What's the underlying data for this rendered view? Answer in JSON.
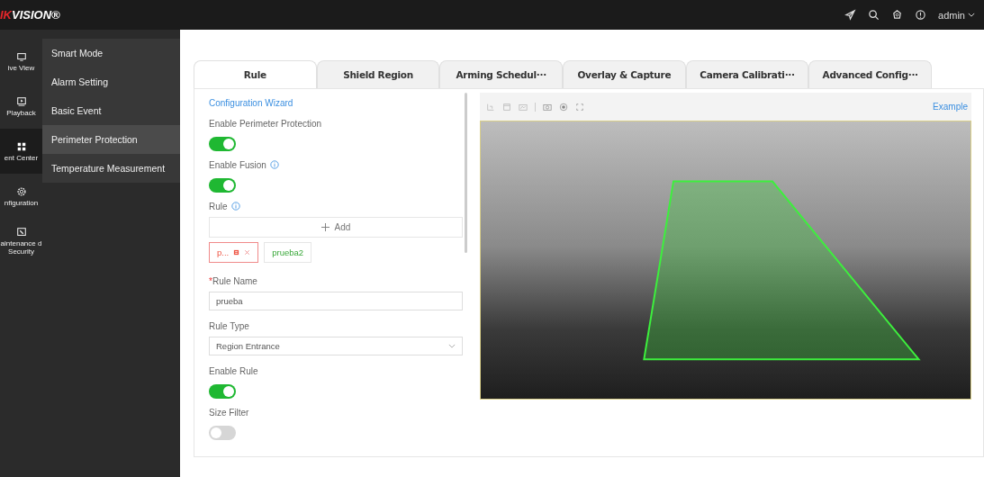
{
  "logo": {
    "accent": "IK",
    "rest": "VISION®"
  },
  "topbar": {
    "user": "admin"
  },
  "nav": [
    {
      "label": "ive View",
      "selected": false
    },
    {
      "label": "Playback",
      "selected": false
    },
    {
      "label": "ent Center",
      "selected": true
    },
    {
      "label": "nfiguration",
      "selected": false
    },
    {
      "label": "aintenance d Security",
      "selected": false
    }
  ],
  "submenu": [
    {
      "label": "Smart Mode",
      "selected": false
    },
    {
      "label": "Alarm Setting",
      "selected": false
    },
    {
      "label": "Basic Event",
      "selected": false
    },
    {
      "label": "Perimeter Protection",
      "selected": true
    },
    {
      "label": "Temperature Measurement",
      "selected": false
    }
  ],
  "tabs": [
    {
      "label": "Rule",
      "selected": true
    },
    {
      "label": "Shield Region",
      "selected": false
    },
    {
      "label": "Arming Schedul···",
      "selected": false
    },
    {
      "label": "Overlay & Capture",
      "selected": false
    },
    {
      "label": "Camera Calibrati···",
      "selected": false
    },
    {
      "label": "Advanced Config···",
      "selected": false
    }
  ],
  "form": {
    "wizard": "Configuration Wizard",
    "fields": [
      {
        "kind": "toggle",
        "label": "Enable Perimeter Protection",
        "info": false,
        "on": true
      },
      {
        "kind": "toggle",
        "label": "Enable Fusion",
        "info": true,
        "on": true
      },
      {
        "kind": "rules",
        "label": "Rule",
        "info": true,
        "add": "Add",
        "items": [
          {
            "label": "p...",
            "selected": true
          },
          {
            "label": "prueba2",
            "selected": false
          }
        ]
      },
      {
        "kind": "text",
        "label": "Rule Name",
        "mark": "*",
        "value": "prueba"
      },
      {
        "kind": "select",
        "label": "Rule Type",
        "value": "Region Entrance"
      },
      {
        "kind": "toggle",
        "label": "Enable Rule",
        "on": true
      },
      {
        "kind": "toggle",
        "label": "Size Filter",
        "on": false
      }
    ]
  },
  "video": {
    "example": "Example"
  }
}
